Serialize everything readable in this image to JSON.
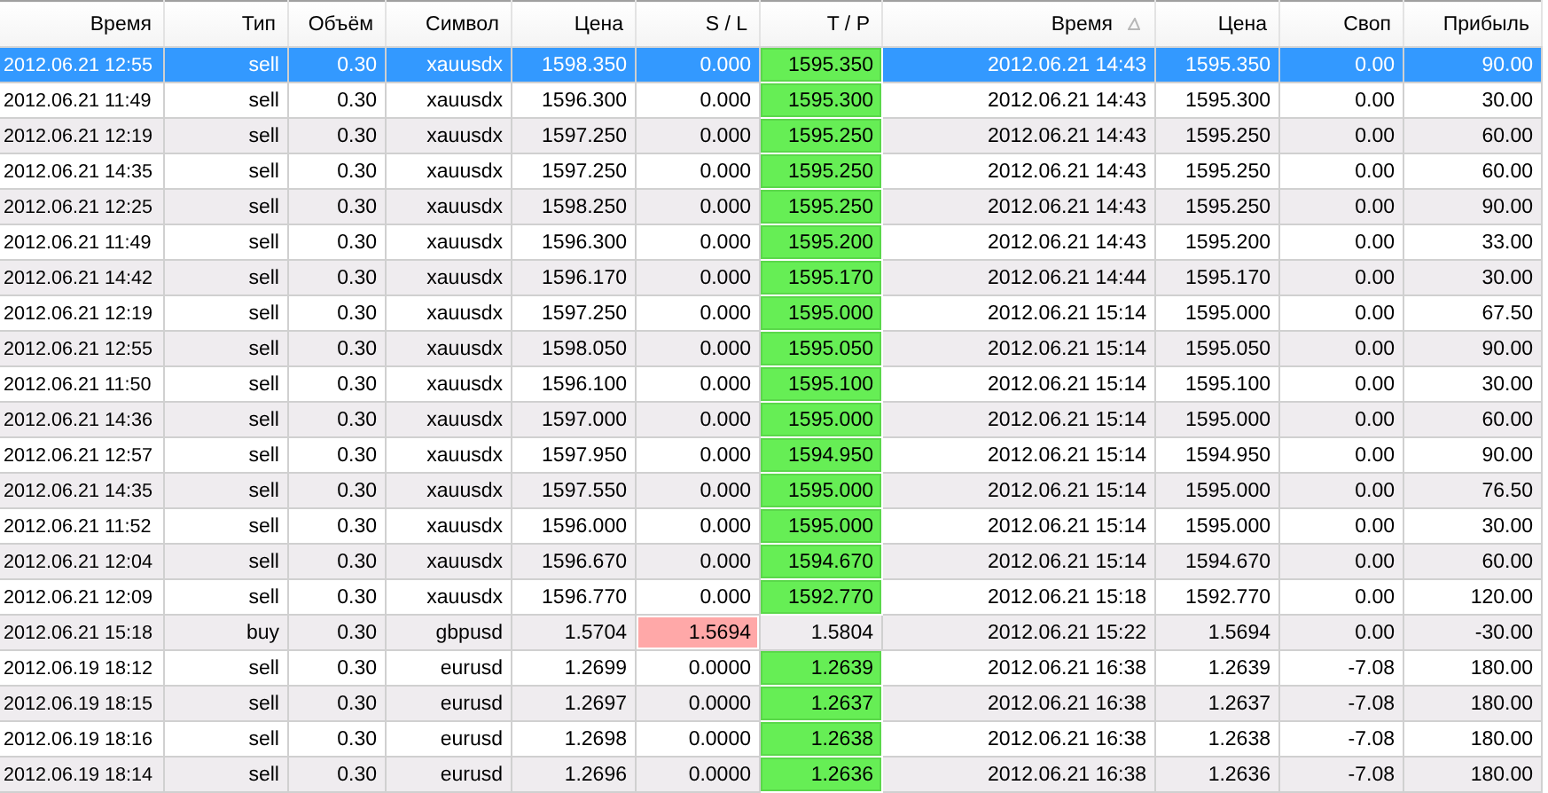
{
  "columns": [
    {
      "label": "Время",
      "sorted": false
    },
    {
      "label": "Тип",
      "sorted": false
    },
    {
      "label": "Объём",
      "sorted": false
    },
    {
      "label": "Символ",
      "sorted": false
    },
    {
      "label": "Цена",
      "sorted": false
    },
    {
      "label": "S / L",
      "sorted": false
    },
    {
      "label": "T / P",
      "sorted": false
    },
    {
      "label": "Время",
      "sorted": true
    },
    {
      "label": "Цена",
      "sorted": false
    },
    {
      "label": "Своп",
      "sorted": false
    },
    {
      "label": "Прибыль",
      "sorted": false
    }
  ],
  "rows": [
    {
      "cells": [
        "2012.06.21 12:55",
        "sell",
        "0.30",
        "xauusdx",
        "1598.350",
        "0.000",
        "1595.350",
        "2012.06.21 14:43",
        "1595.350",
        "0.00",
        "90.00"
      ],
      "selected": true,
      "sl_hit": false,
      "tp_hit": true
    },
    {
      "cells": [
        "2012.06.21 11:49",
        "sell",
        "0.30",
        "xauusdx",
        "1596.300",
        "0.000",
        "1595.300",
        "2012.06.21 14:43",
        "1595.300",
        "0.00",
        "30.00"
      ],
      "selected": false,
      "sl_hit": false,
      "tp_hit": true
    },
    {
      "cells": [
        "2012.06.21 12:19",
        "sell",
        "0.30",
        "xauusdx",
        "1597.250",
        "0.000",
        "1595.250",
        "2012.06.21 14:43",
        "1595.250",
        "0.00",
        "60.00"
      ],
      "selected": false,
      "sl_hit": false,
      "tp_hit": true
    },
    {
      "cells": [
        "2012.06.21 14:35",
        "sell",
        "0.30",
        "xauusdx",
        "1597.250",
        "0.000",
        "1595.250",
        "2012.06.21 14:43",
        "1595.250",
        "0.00",
        "60.00"
      ],
      "selected": false,
      "sl_hit": false,
      "tp_hit": true
    },
    {
      "cells": [
        "2012.06.21 12:25",
        "sell",
        "0.30",
        "xauusdx",
        "1598.250",
        "0.000",
        "1595.250",
        "2012.06.21 14:43",
        "1595.250",
        "0.00",
        "90.00"
      ],
      "selected": false,
      "sl_hit": false,
      "tp_hit": true
    },
    {
      "cells": [
        "2012.06.21 11:49",
        "sell",
        "0.30",
        "xauusdx",
        "1596.300",
        "0.000",
        "1595.200",
        "2012.06.21 14:43",
        "1595.200",
        "0.00",
        "33.00"
      ],
      "selected": false,
      "sl_hit": false,
      "tp_hit": true
    },
    {
      "cells": [
        "2012.06.21 14:42",
        "sell",
        "0.30",
        "xauusdx",
        "1596.170",
        "0.000",
        "1595.170",
        "2012.06.21 14:44",
        "1595.170",
        "0.00",
        "30.00"
      ],
      "selected": false,
      "sl_hit": false,
      "tp_hit": true
    },
    {
      "cells": [
        "2012.06.21 12:19",
        "sell",
        "0.30",
        "xauusdx",
        "1597.250",
        "0.000",
        "1595.000",
        "2012.06.21 15:14",
        "1595.000",
        "0.00",
        "67.50"
      ],
      "selected": false,
      "sl_hit": false,
      "tp_hit": true
    },
    {
      "cells": [
        "2012.06.21 12:55",
        "sell",
        "0.30",
        "xauusdx",
        "1598.050",
        "0.000",
        "1595.050",
        "2012.06.21 15:14",
        "1595.050",
        "0.00",
        "90.00"
      ],
      "selected": false,
      "sl_hit": false,
      "tp_hit": true
    },
    {
      "cells": [
        "2012.06.21 11:50",
        "sell",
        "0.30",
        "xauusdx",
        "1596.100",
        "0.000",
        "1595.100",
        "2012.06.21 15:14",
        "1595.100",
        "0.00",
        "30.00"
      ],
      "selected": false,
      "sl_hit": false,
      "tp_hit": true
    },
    {
      "cells": [
        "2012.06.21 14:36",
        "sell",
        "0.30",
        "xauusdx",
        "1597.000",
        "0.000",
        "1595.000",
        "2012.06.21 15:14",
        "1595.000",
        "0.00",
        "60.00"
      ],
      "selected": false,
      "sl_hit": false,
      "tp_hit": true
    },
    {
      "cells": [
        "2012.06.21 12:57",
        "sell",
        "0.30",
        "xauusdx",
        "1597.950",
        "0.000",
        "1594.950",
        "2012.06.21 15:14",
        "1594.950",
        "0.00",
        "90.00"
      ],
      "selected": false,
      "sl_hit": false,
      "tp_hit": true
    },
    {
      "cells": [
        "2012.06.21 14:35",
        "sell",
        "0.30",
        "xauusdx",
        "1597.550",
        "0.000",
        "1595.000",
        "2012.06.21 15:14",
        "1595.000",
        "0.00",
        "76.50"
      ],
      "selected": false,
      "sl_hit": false,
      "tp_hit": true
    },
    {
      "cells": [
        "2012.06.21 11:52",
        "sell",
        "0.30",
        "xauusdx",
        "1596.000",
        "0.000",
        "1595.000",
        "2012.06.21 15:14",
        "1595.000",
        "0.00",
        "30.00"
      ],
      "selected": false,
      "sl_hit": false,
      "tp_hit": true
    },
    {
      "cells": [
        "2012.06.21 12:04",
        "sell",
        "0.30",
        "xauusdx",
        "1596.670",
        "0.000",
        "1594.670",
        "2012.06.21 15:14",
        "1594.670",
        "0.00",
        "60.00"
      ],
      "selected": false,
      "sl_hit": false,
      "tp_hit": true
    },
    {
      "cells": [
        "2012.06.21 12:09",
        "sell",
        "0.30",
        "xauusdx",
        "1596.770",
        "0.000",
        "1592.770",
        "2012.06.21 15:18",
        "1592.770",
        "0.00",
        "120.00"
      ],
      "selected": false,
      "sl_hit": false,
      "tp_hit": true
    },
    {
      "cells": [
        "2012.06.21 15:18",
        "buy",
        "0.30",
        "gbpusd",
        "1.5704",
        "1.5694",
        "1.5804",
        "2012.06.21 15:22",
        "1.5694",
        "0.00",
        "-30.00"
      ],
      "selected": false,
      "sl_hit": true,
      "tp_hit": false
    },
    {
      "cells": [
        "2012.06.19 18:12",
        "sell",
        "0.30",
        "eurusd",
        "1.2699",
        "0.0000",
        "1.2639",
        "2012.06.21 16:38",
        "1.2639",
        "-7.08",
        "180.00"
      ],
      "selected": false,
      "sl_hit": false,
      "tp_hit": true
    },
    {
      "cells": [
        "2012.06.19 18:15",
        "sell",
        "0.30",
        "eurusd",
        "1.2697",
        "0.0000",
        "1.2637",
        "2012.06.21 16:38",
        "1.2637",
        "-7.08",
        "180.00"
      ],
      "selected": false,
      "sl_hit": false,
      "tp_hit": true
    },
    {
      "cells": [
        "2012.06.19 18:16",
        "sell",
        "0.30",
        "eurusd",
        "1.2698",
        "0.0000",
        "1.2638",
        "2012.06.21 16:38",
        "1.2638",
        "-7.08",
        "180.00"
      ],
      "selected": false,
      "sl_hit": false,
      "tp_hit": true
    },
    {
      "cells": [
        "2012.06.19 18:14",
        "sell",
        "0.30",
        "eurusd",
        "1.2696",
        "0.0000",
        "1.2636",
        "2012.06.21 16:38",
        "1.2636",
        "-7.08",
        "180.00"
      ],
      "selected": false,
      "sl_hit": false,
      "tp_hit": true
    }
  ]
}
